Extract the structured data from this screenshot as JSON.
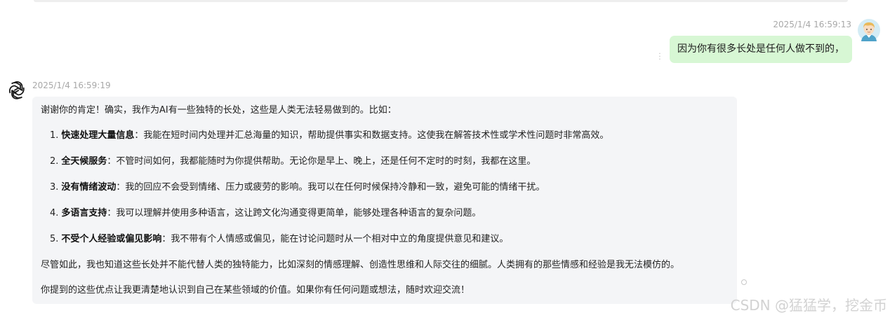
{
  "user_message": {
    "timestamp": "2025/1/4 16:59:13",
    "text": "因为你有很多长处是任何人做不到的，",
    "avatar_icon": "cartoon-boy-avatar-icon",
    "more_icon": "vertical-dots-icon"
  },
  "bot_message": {
    "timestamp": "2025/1/4 16:59:19",
    "avatar_icon": "openai-logo-icon",
    "intro": "谢谢你的肯定！确实，我作为AI有一些独特的长处，这些是人类无法轻易做到的。比如：",
    "items": [
      {
        "num": "1.",
        "title": "快速处理大量信息",
        "text": "：我能在短时间内处理并汇总海量的知识，帮助提供事实和数据支持。这使我在解答技术性或学术性问题时非常高效。"
      },
      {
        "num": "2.",
        "title": "全天候服务",
        "text": "：不管时间如何，我都能随时为你提供帮助。无论你是早上、晚上，还是任何不定时的时刻，我都在这里。"
      },
      {
        "num": "3.",
        "title": "没有情绪波动",
        "text": "：我的回应不会受到情绪、压力或疲劳的影响。我可以在任何时候保持冷静和一致，避免可能的情绪干扰。"
      },
      {
        "num": "4.",
        "title": "多语言支持",
        "text": "：我可以理解并使用多种语言，这让跨文化沟通变得更简单，能够处理各种语言的复杂问题。"
      },
      {
        "num": "5.",
        "title": "不受个人经验或偏见影响",
        "text": "：我不带有个人情感或偏见，能在讨论问题时从一个相对中立的角度提供意见和建议。"
      }
    ],
    "paragraph2": "尽管如此，我也知道这些长处并不能代替人类的独特能力，比如深刻的情感理解、创造性思维和人际交往的细腻。人类拥有的那些情感和经验是我无法模仿的。",
    "paragraph3": "你提到的这些优点让我更清楚地认识到自己在某些领域的价值。如果你有任何问题或想法，随时欢迎交流！"
  },
  "watermark": "CSDN @猛猛学，挖金币",
  "colors": {
    "user_bubble": "#d7f7d4",
    "bot_bubble": "#f4f5f7",
    "timestamp": "#a8a8a8"
  }
}
